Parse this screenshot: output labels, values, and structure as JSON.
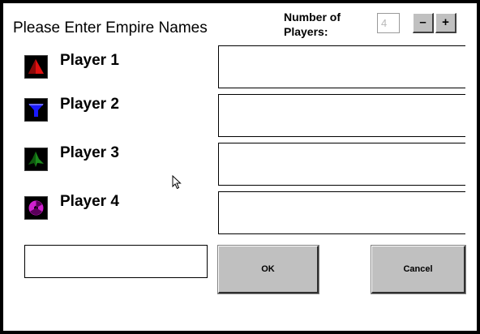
{
  "dialog": {
    "title": "Please Enter Empire Names",
    "num_players": {
      "label_line1": "Number of",
      "label_line2": "Players:",
      "value": "4",
      "decrement_label": "–",
      "increment_label": "+"
    },
    "players": [
      {
        "label": "Player 1",
        "icon": "red-pyramid-icon",
        "color": "#e01010",
        "name": ""
      },
      {
        "label": "Player 2",
        "icon": "blue-funnel-icon",
        "color": "#1a1aff",
        "name": ""
      },
      {
        "label": "Player 3",
        "icon": "green-tree-icon",
        "color": "#1c8a1c",
        "name": ""
      },
      {
        "label": "Player 4",
        "icon": "purple-radiation-icon",
        "color": "#d020d0",
        "name": ""
      }
    ],
    "ok_label": "OK",
    "cancel_label": "Cancel"
  },
  "colors": {
    "button_face": "#c0c0c0",
    "border": "#000000",
    "background": "#ffffff"
  }
}
